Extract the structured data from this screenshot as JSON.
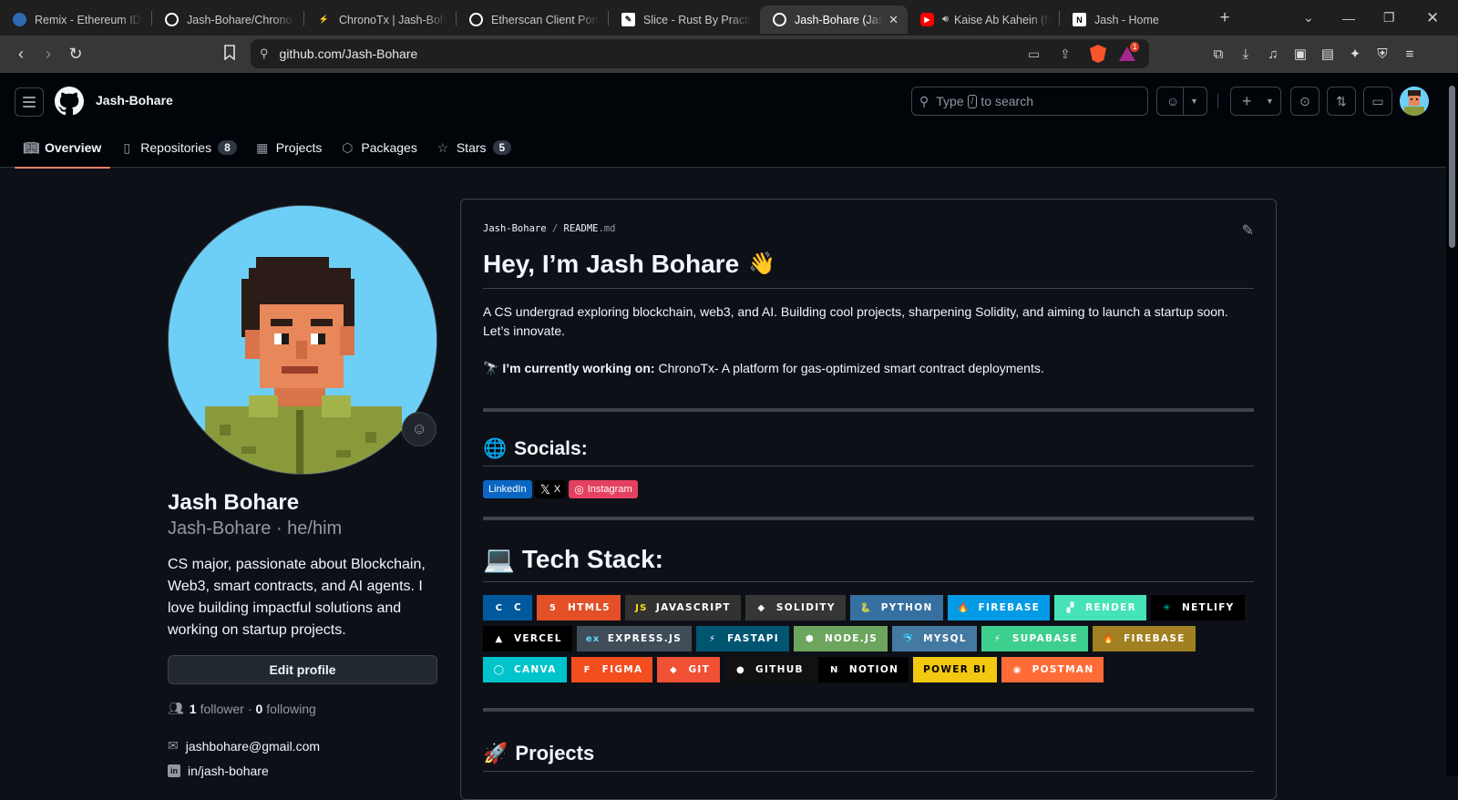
{
  "browser": {
    "tabs": [
      {
        "title": "Remix - Ethereum IDE",
        "icon": "remix-icon",
        "color": "#2d6cb5"
      },
      {
        "title": "Jash-Bohare/ChronoTx",
        "icon": "github-icon",
        "color": "#ffffff"
      },
      {
        "title": "ChronoTx | Jash-Bohare",
        "icon": "bolt-icon",
        "color": "#3ecf8e"
      },
      {
        "title": "Etherscan Client Portal",
        "icon": "etherscan-icon",
        "color": "#ffffff"
      },
      {
        "title": "Slice - Rust By Practice",
        "icon": "book-icon",
        "color": "#ffffff"
      },
      {
        "title": "Jash-Bohare (Jash",
        "icon": "github-icon",
        "color": "#ffffff",
        "active": true
      },
      {
        "title": "Kaise Ab Kahein (fe",
        "icon": "youtube-icon",
        "color": "#ff0000"
      },
      {
        "title": "Jash - Home",
        "icon": "notion-icon",
        "color": "#ffffff"
      }
    ],
    "url": "github.com/Jash-Bohare",
    "notification_count": "1"
  },
  "github": {
    "username": "Jash-Bohare",
    "search_prefix": "Type",
    "search_key": "/",
    "search_suffix": "to search",
    "nav": [
      {
        "label": "Overview",
        "icon": "book-icon",
        "selected": true
      },
      {
        "label": "Repositories",
        "icon": "repo-icon",
        "count": "8"
      },
      {
        "label": "Projects",
        "icon": "table-icon"
      },
      {
        "label": "Packages",
        "icon": "package-icon"
      },
      {
        "label": "Stars",
        "icon": "star-icon",
        "count": "5"
      }
    ]
  },
  "profile": {
    "name": "Jash Bohare",
    "login_pronouns": "Jash-Bohare · he/him",
    "bio": "CS major, passionate about Blockchain, Web3, smart contracts, and AI agents. I love building impactful solutions and working on startup projects.",
    "edit_label": "Edit profile",
    "followers": "1",
    "followers_label": "follower",
    "following": "0",
    "following_label": "following",
    "email": "jashbohare@gmail.com",
    "linkedin": "in/jash-bohare"
  },
  "readme": {
    "path_owner": "Jash-Bohare",
    "path_sep": "/",
    "path_file": "README",
    "path_ext": ".md",
    "heading": "Hey, I’m Jash Bohare",
    "heading_emoji": "👋",
    "intro": "A CS undergrad exploring blockchain, web3, and AI. Building cool projects, sharpening Solidity, and aiming to launch a startup soon. Let’s innovate.",
    "working_emoji": "🔭",
    "working_label": "I’m currently working on:",
    "working_text": "ChronoTx- A platform for gas-optimized smart contract deployments.",
    "socials_emoji": "🌐",
    "socials_heading": "Socials:",
    "socials": [
      {
        "label": "LinkedIn",
        "color": "#0a66c2",
        "icon": ""
      },
      {
        "label": "X",
        "color": "#000000",
        "icon": "x-icon"
      },
      {
        "label": "Instagram",
        "color": "#e4405f",
        "icon": "instagram-icon"
      }
    ],
    "tech_emoji": "💻",
    "tech_heading": "Tech Stack:",
    "tech": [
      {
        "label": "C",
        "color": "#00599c",
        "icon": "C",
        "fg": "#ffffff"
      },
      {
        "label": "HTML5",
        "color": "#e34f26",
        "icon": "5",
        "fg": "#ffffff"
      },
      {
        "label": "JAVASCRIPT",
        "color": "#323330",
        "icon": "JS",
        "fg": "#f7df1e"
      },
      {
        "label": "SOLIDITY",
        "color": "#363636",
        "icon": "◆",
        "fg": "#ffffff"
      },
      {
        "label": "PYTHON",
        "color": "#3670a0",
        "icon": "🐍",
        "fg": "#ffdd54"
      },
      {
        "label": "FIREBASE",
        "color": "#039be5",
        "icon": "🔥",
        "fg": "#ffffff"
      },
      {
        "label": "RENDER",
        "color": "#46e3b7",
        "icon": "▞",
        "fg": "#ffffff"
      },
      {
        "label": "NETLIFY",
        "color": "#000000",
        "icon": "✳",
        "fg": "#00c7b7"
      },
      {
        "label": "VERCEL",
        "color": "#000000",
        "icon": "▲",
        "fg": "#ffffff"
      },
      {
        "label": "EXPRESS.JS",
        "color": "#404d59",
        "icon": "ex",
        "fg": "#61dafb"
      },
      {
        "label": "FASTAPI",
        "color": "#005571",
        "icon": "⚡",
        "fg": "#ffffff"
      },
      {
        "label": "NODE.JS",
        "color": "#6da55f",
        "icon": "⬢",
        "fg": "#ffffff"
      },
      {
        "label": "MYSQL",
        "color": "#4479a1",
        "icon": "🐬",
        "fg": "#ffffff"
      },
      {
        "label": "SUPABASE",
        "color": "#3ecf8e",
        "icon": "⚡",
        "fg": "#ffffff"
      },
      {
        "label": "FIREBASE",
        "color": "#a08021",
        "icon": "🔥",
        "fg": "#ffca28"
      },
      {
        "label": "CANVA",
        "color": "#00c4cc",
        "icon": "◯",
        "fg": "#ffffff"
      },
      {
        "label": "FIGMA",
        "color": "#f24e1e",
        "icon": "F",
        "fg": "#ffffff"
      },
      {
        "label": "GIT",
        "color": "#f05033",
        "icon": "◆",
        "fg": "#ffffff"
      },
      {
        "label": "GITHUB",
        "color": "#121011",
        "icon": "●",
        "fg": "#ffffff"
      },
      {
        "label": "NOTION",
        "color": "#000000",
        "icon": "N",
        "fg": "#ffffff"
      },
      {
        "label": "POWER BI",
        "color": "#f2c811",
        "icon": "",
        "fg": "#000000"
      },
      {
        "label": "POSTMAN",
        "color": "#ff6c37",
        "icon": "◉",
        "fg": "#ffffff"
      }
    ],
    "projects_emoji": "🚀",
    "projects_heading": "Projects"
  },
  "colors": {
    "accent_underline": "#f78166",
    "bg": "#0d1117",
    "border": "#3d444d"
  }
}
